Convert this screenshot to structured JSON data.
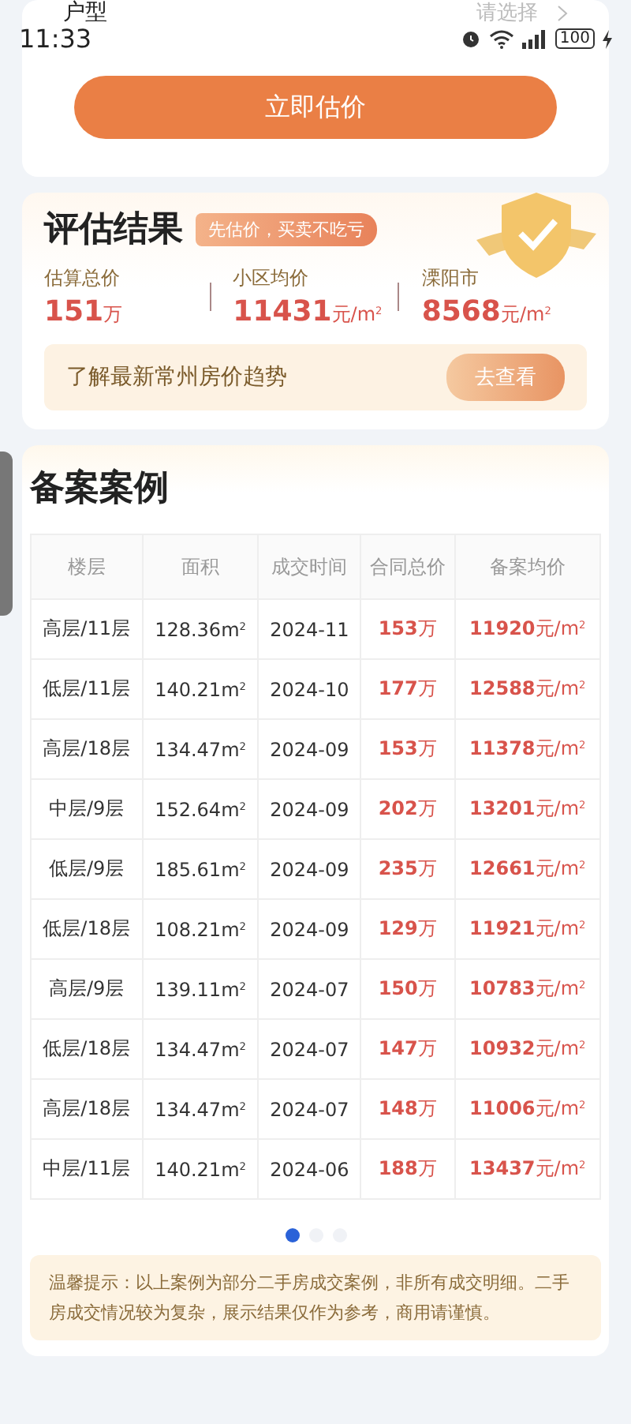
{
  "top_row": {
    "label": "户型",
    "placeholder": "请选择"
  },
  "status_bar": {
    "time": "11:33",
    "battery": "100"
  },
  "estimate_button": "立即估价",
  "result": {
    "title": "评估结果",
    "tag": "先估价，买卖不吃亏",
    "stats": [
      {
        "label": "估算总价",
        "value": "151",
        "unit": "万"
      },
      {
        "label": "小区均价",
        "value": "11431",
        "unit": "元/m$^{2}$"
      },
      {
        "label": "溧阳市",
        "value": "8568",
        "unit": "元/m$^{2}$"
      }
    ],
    "trend": {
      "text": "了解最新常州房价趋势",
      "button": "去查看"
    }
  },
  "cases": {
    "title": "备案案例",
    "columns": [
      "楼层",
      "面积",
      "成交时间",
      "合同总价",
      "备案均价"
    ],
    "rows": [
      [
        "高层/11层",
        "128.36m$^{2}$",
        "2024-11",
        "**153**万",
        "**11920**元/m$^{2}$"
      ],
      [
        "低层/11层",
        "140.21m$^{2}$",
        "2024-10",
        "**177**万",
        "**12588**元/m$^{2}$"
      ],
      [
        "高层/18层",
        "134.47m$^{2}$",
        "2024-09",
        "**153**万",
        "**11378**元/m$^{2}$"
      ],
      [
        "中层/9层",
        "152.64m$^{2}$",
        "2024-09",
        "**202**万",
        "**13201**元/m$^{2}$"
      ],
      [
        "低层/9层",
        "185.61m$^{2}$",
        "2024-09",
        "**235**万",
        "**12661**元/m$^{2}$"
      ],
      [
        "低层/18层",
        "108.21m$^{2}$",
        "2024-09",
        "**129**万",
        "**11921**元/m$^{2}$"
      ],
      [
        "高层/9层",
        "139.11m$^{2}$",
        "2024-07",
        "**150**万",
        "**10783**元/m$^{2}$"
      ],
      [
        "低层/18层",
        "134.47m$^{2}$",
        "2024-07",
        "**147**万",
        "**10932**元/m$^{2}$"
      ],
      [
        "高层/18层",
        "134.47m$^{2}$",
        "2024-07",
        "**148**万",
        "**11006**元/m$^{2}$"
      ],
      [
        "中层/11层",
        "140.21m$^{2}$",
        "2024-06",
        "**188**万",
        "**13437**元/m$^{2}$"
      ]
    ],
    "pages": [
      {
        "selected": true
      },
      {
        "selected": false
      },
      {
        "selected": false
      }
    ],
    "note": "温馨提示：以上案例为部分二手房成交案例，非所有成交明细。二手房成交情况较为复杂，展示结果仅作为参考，商用请谨慎。"
  }
}
